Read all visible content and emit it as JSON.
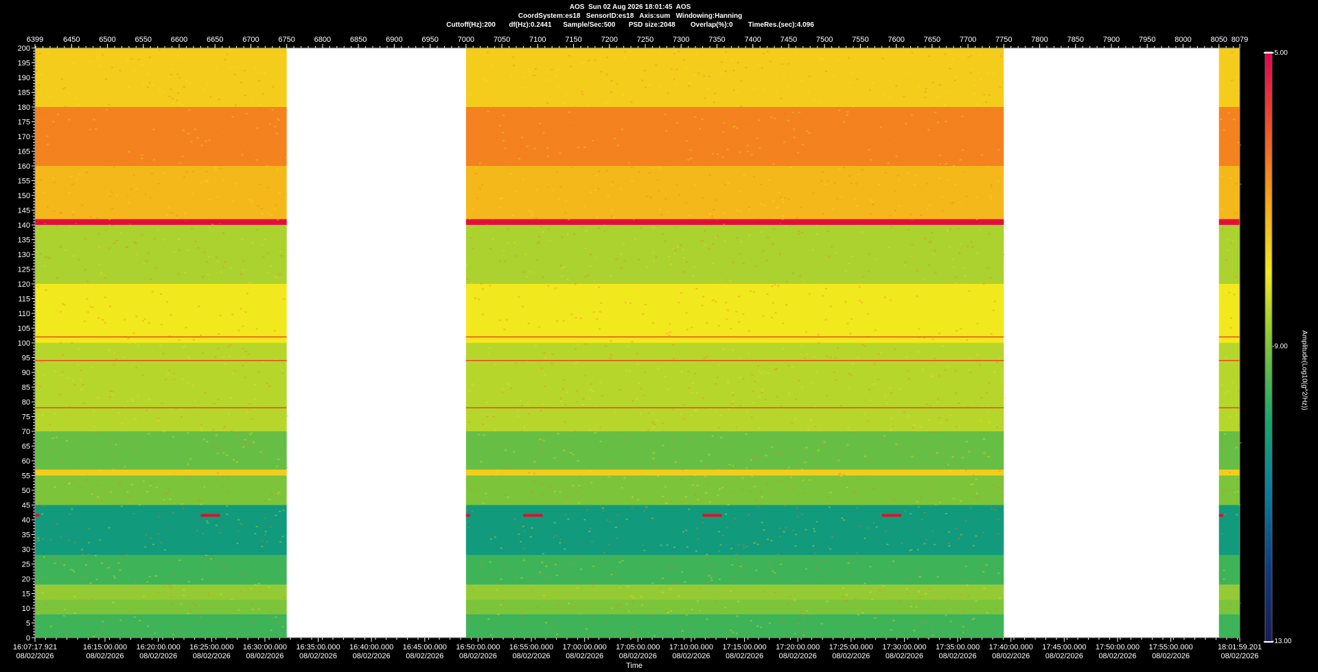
{
  "header": {
    "line1": "AOS  Sun 02 Aug 2026 18:01:45  AOS",
    "line2": "CoordSystem:es18   SensorID:es18   Axis:sum   Windowing:Hanning",
    "line3": "Cuttoff(Hz):200       df(Hz):0.2441      Sample/Sec:500       PSD size:2048        Overlap(%):0        TimeRes.(sec):4.096"
  },
  "chart_data": {
    "type": "heatmap",
    "title": "AOS  Sun 02 Aug 2026 18:01:45  AOS",
    "xlabel": "Time",
    "ylabel": "",
    "ylim": [
      0,
      200
    ],
    "yticks": [
      0,
      5,
      10,
      15,
      20,
      25,
      30,
      35,
      40,
      45,
      50,
      55,
      60,
      65,
      70,
      75,
      80,
      85,
      90,
      95,
      100,
      105,
      110,
      115,
      120,
      125,
      130,
      135,
      140,
      145,
      150,
      155,
      160,
      165,
      170,
      175,
      180,
      185,
      190,
      195,
      200
    ],
    "xlim_top": [
      6399,
      8079
    ],
    "xticks_top": [
      "6399",
      "6450",
      "6500",
      "6550",
      "6600",
      "6650",
      "6700",
      "6750",
      "6800",
      "6850",
      "6900",
      "6950",
      "7000",
      "7050",
      "7100",
      "7150",
      "7200",
      "7250",
      "7300",
      "7350",
      "7400",
      "7450",
      "7500",
      "7550",
      "7600",
      "7650",
      "7700",
      "7750",
      "7800",
      "7850",
      "7900",
      "7950",
      "8000",
      "8050",
      "8079"
    ],
    "xticks_bottom": [
      {
        "time": "16:07:17.921",
        "date": "08/02/2026"
      },
      {
        "time": "16:15:00.000",
        "date": "08/02/2026"
      },
      {
        "time": "16:20:00.000",
        "date": "08/02/2026"
      },
      {
        "time": "16:25:00.000",
        "date": "08/02/2026"
      },
      {
        "time": "16:30:00.000",
        "date": "08/02/2026"
      },
      {
        "time": "16:35:00.000",
        "date": "08/02/2026"
      },
      {
        "time": "16:40:00.000",
        "date": "08/02/2026"
      },
      {
        "time": "16:45:00.000",
        "date": "08/02/2026"
      },
      {
        "time": "16:50:00.000",
        "date": "08/02/2026"
      },
      {
        "time": "16:55:00.000",
        "date": "08/02/2026"
      },
      {
        "time": "17:00:00.000",
        "date": "08/02/2026"
      },
      {
        "time": "17:05:00.000",
        "date": "08/02/2026"
      },
      {
        "time": "17:10:00.000",
        "date": "08/02/2026"
      },
      {
        "time": "17:15:00.000",
        "date": "08/02/2026"
      },
      {
        "time": "17:20:00.000",
        "date": "08/02/2026"
      },
      {
        "time": "17:25:00.000",
        "date": "08/02/2026"
      },
      {
        "time": "17:30:00.000",
        "date": "08/02/2026"
      },
      {
        "time": "17:35:00.000",
        "date": "08/02/2026"
      },
      {
        "time": "17:40:00.000",
        "date": "08/02/2026"
      },
      {
        "time": "17:45:00.000",
        "date": "08/02/2026"
      },
      {
        "time": "17:50:00.000",
        "date": "08/02/2026"
      },
      {
        "time": "17:55:00.000",
        "date": "08/02/2026"
      },
      {
        "time": "18:01:59.201",
        "date": "08/02/2026"
      }
    ],
    "data_gaps_top_units": [
      [
        6750,
        7000
      ],
      [
        7750,
        8050
      ]
    ],
    "spectral_bands": [
      {
        "hz": [
          0,
          8
        ],
        "level": -9.6
      },
      {
        "hz": [
          8,
          13
        ],
        "level": -9.0
      },
      {
        "hz": [
          13,
          18
        ],
        "level": -8.8
      },
      {
        "hz": [
          18,
          28
        ],
        "level": -9.6
      },
      {
        "hz": [
          28,
          45
        ],
        "level": -10.3
      },
      {
        "hz": [
          45,
          55
        ],
        "level": -9.0
      },
      {
        "hz": [
          55,
          57
        ],
        "level": -7.6
      },
      {
        "hz": [
          57,
          70
        ],
        "level": -9.2
      },
      {
        "hz": [
          70,
          100
        ],
        "level": -8.5
      },
      {
        "hz": [
          100,
          120
        ],
        "level": -8.0
      },
      {
        "hz": [
          120,
          140
        ],
        "level": -8.6
      },
      {
        "hz": [
          140,
          142
        ],
        "level": -5.2
      },
      {
        "hz": [
          142,
          160
        ],
        "level": -7.3
      },
      {
        "hz": [
          160,
          180
        ],
        "level": -6.6
      },
      {
        "hz": [
          180,
          200
        ],
        "level": -7.6
      }
    ],
    "tones_hz": [
      94,
      102,
      78,
      141
    ],
    "intermittent_tone_hz": 41.5,
    "colorbar": {
      "label": "Amplitude(Log10(g^2/Hz))",
      "max": -5.0,
      "mid": -9.0,
      "min": -13.0,
      "colors": [
        "#e00050",
        "#f0502a",
        "#f6a418",
        "#f2e81e",
        "#7cc43a",
        "#14a86c",
        "#0a7aa0",
        "#0f3c80",
        "#1a1a5a"
      ]
    }
  },
  "colorbar_labels": {
    "max": "-5.00",
    "mid": "-9.00",
    "min": "-13.00",
    "label": "Amplitude(Log10(g^2/Hz))"
  }
}
